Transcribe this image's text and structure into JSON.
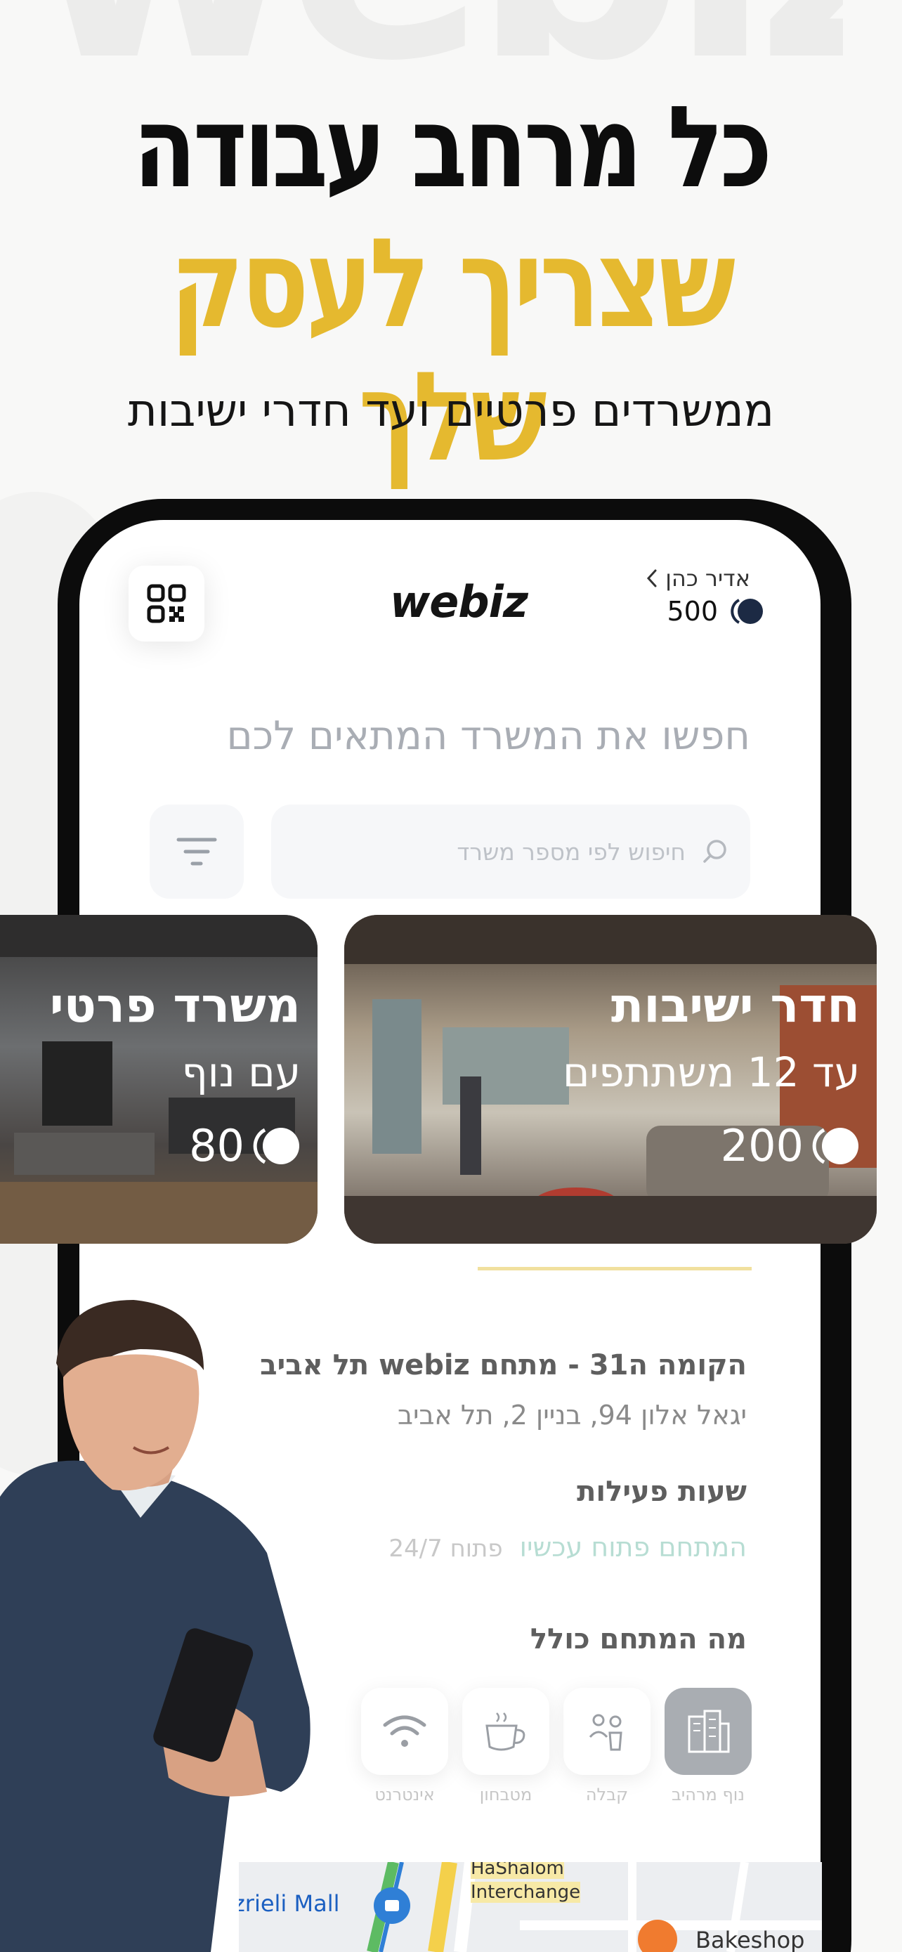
{
  "background_word": "webiz",
  "hero": {
    "line1": "כל מרחב עבודה",
    "line2": "שצריך לעסק שלך",
    "subtitle": "ממשרדים פרטיים ועד חדרי ישיבות"
  },
  "header": {
    "logo": "webiz",
    "user_name": "אדיר כהן",
    "credits": "500"
  },
  "search": {
    "title": "חפשו את המשרד המתאים לכם",
    "placeholder": "חיפוש לפי מספר משרד"
  },
  "cards": [
    {
      "title": "חדר ישיבות",
      "subtitle": "עד 12 משתתפים",
      "price": "200"
    },
    {
      "title": "משרד פרטי",
      "subtitle": "עם נוף",
      "price": "80"
    }
  ],
  "venue": {
    "title": "הקומה ה31 - מתחם webiz תל אביב",
    "address": "יגאל אלון 94, בניין 2, תל אביב"
  },
  "hours": {
    "title": "שעות פעילות",
    "status": "המתחם פתוח עכשיו",
    "detail": "פתוח 24/7"
  },
  "includes": {
    "title": "מה המתחם כולל",
    "items": [
      {
        "label": "נוף מרהיב",
        "icon": "buildings-icon"
      },
      {
        "label": "קבלה",
        "icon": "reception-icon"
      },
      {
        "label": "מטבחון",
        "icon": "coffee-cup-icon"
      },
      {
        "label": "אינטרנט",
        "icon": "wifi-icon"
      }
    ]
  },
  "map": {
    "label_mall": "zrieli Mall",
    "label_hashalom": "HaShalom",
    "label_interchange": "Interchange",
    "label_bakeshop": "Bakeshop"
  },
  "colors": {
    "accent_yellow": "#e5b92f",
    "navy": "#1c2a44",
    "open_green": "#b7ddd3"
  }
}
